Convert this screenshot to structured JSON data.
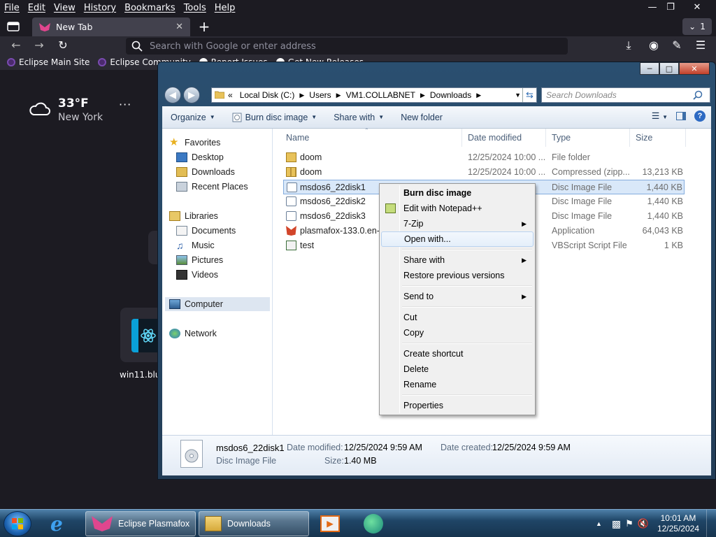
{
  "browser": {
    "menu": [
      "File",
      "Edit",
      "View",
      "History",
      "Bookmarks",
      "Tools",
      "Help"
    ],
    "tab_title": "New Tab",
    "tab_count": "1",
    "url_placeholder": "Search with Google or enter address",
    "bookmarks": [
      "Eclipse Main Site",
      "Eclipse Community",
      "Report Issues",
      "Get New Releases"
    ]
  },
  "newtab": {
    "weather_temp": "33°F",
    "weather_city": "New York",
    "more": "···",
    "shortcut_label": "win11.blu"
  },
  "explorer": {
    "breadcrumb": [
      "Local Disk (C:)",
      "Users",
      "VM1.COLLABNET",
      "Downloads"
    ],
    "breadcrumb_prefix": "«",
    "search_placeholder": "Search Downloads",
    "toolbar": {
      "organize": "Organize",
      "burn": "Burn disc image",
      "share": "Share with",
      "new_folder": "New folder"
    },
    "nav": {
      "favorites": "Favorites",
      "desktop": "Desktop",
      "downloads": "Downloads",
      "recent": "Recent Places",
      "libraries": "Libraries",
      "documents": "Documents",
      "music": "Music",
      "pictures": "Pictures",
      "videos": "Videos",
      "computer": "Computer",
      "network": "Network"
    },
    "columns": {
      "name": "Name",
      "date": "Date modified",
      "type": "Type",
      "size": "Size"
    },
    "files": [
      {
        "name": "doom",
        "date": "12/25/2024 10:00 ...",
        "type": "File folder",
        "size": ""
      },
      {
        "name": "doom",
        "date": "12/25/2024 10:00 ...",
        "type": "Compressed (zipp...",
        "size": "13,213 KB"
      },
      {
        "name": "msdos6_22disk1",
        "date": "",
        "type": "Disc Image File",
        "size": "1,440 KB"
      },
      {
        "name": "msdos6_22disk2",
        "date": "",
        "type": "Disc Image File",
        "size": "1,440 KB"
      },
      {
        "name": "msdos6_22disk3",
        "date": "",
        "type": "Disc Image File",
        "size": "1,440 KB"
      },
      {
        "name": "plasmafox-133.0.en-U",
        "date": "",
        "type": "Application",
        "size": "64,043 KB"
      },
      {
        "name": "test",
        "date": "",
        "type": "VBScript Script File",
        "size": "1 KB"
      }
    ],
    "details": {
      "name": "msdos6_22disk1",
      "type": "Disc Image File",
      "modified_label": "Date modified:",
      "modified_value": "12/25/2024 9:59 AM",
      "created_label": "Date created:",
      "created_value": "12/25/2024 9:59 AM",
      "size_label": "Size:",
      "size_value": "1.40 MB"
    }
  },
  "context_menu": {
    "burn": "Burn disc image",
    "notepad": "Edit with Notepad++",
    "zip": "7-Zip",
    "open_with": "Open with...",
    "share_with": "Share with",
    "restore": "Restore previous versions",
    "send_to": "Send to",
    "cut": "Cut",
    "copy": "Copy",
    "shortcut": "Create shortcut",
    "delete": "Delete",
    "rename": "Rename",
    "properties": "Properties"
  },
  "taskbar": {
    "plasmafox": "Eclipse Plasmafox",
    "downloads": "Downloads",
    "time": "10:01 AM",
    "date": "12/25/2024"
  }
}
